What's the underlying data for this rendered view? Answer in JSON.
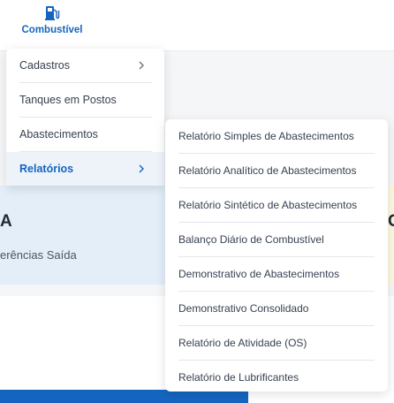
{
  "nav": {
    "label": "Combustível",
    "icon": "fuel-pump-icon",
    "color": "#1565c0"
  },
  "menu": {
    "items": [
      {
        "label": "Cadastros",
        "has_submenu": true
      },
      {
        "label": "Tanques em Postos",
        "has_submenu": false
      },
      {
        "label": "Abastecimentos",
        "has_submenu": false
      },
      {
        "label": "Relatórios",
        "has_submenu": true,
        "active": true
      }
    ]
  },
  "submenu": {
    "items": [
      {
        "label": "Relatório Simples de Abastecimentos"
      },
      {
        "label": "Relatório Analítico de Abastecimentos"
      },
      {
        "label": "Relatório Sintético de Abastecimentos"
      },
      {
        "label": "Balanço Diário de Combustível"
      },
      {
        "label": "Demonstrativo de Abastecimentos"
      },
      {
        "label": "Demonstrativo Consolidado"
      },
      {
        "label": "Relatório de Atividade (OS)"
      },
      {
        "label": "Relatório de Lubrificantes"
      }
    ]
  },
  "background": {
    "heading_left": "A",
    "heading_right": "C",
    "panel_text": "erências Saída"
  },
  "colors": {
    "accent": "#1565c0",
    "panel_blue": "#e3eef8",
    "panel_yellow": "#fdf8e1"
  }
}
